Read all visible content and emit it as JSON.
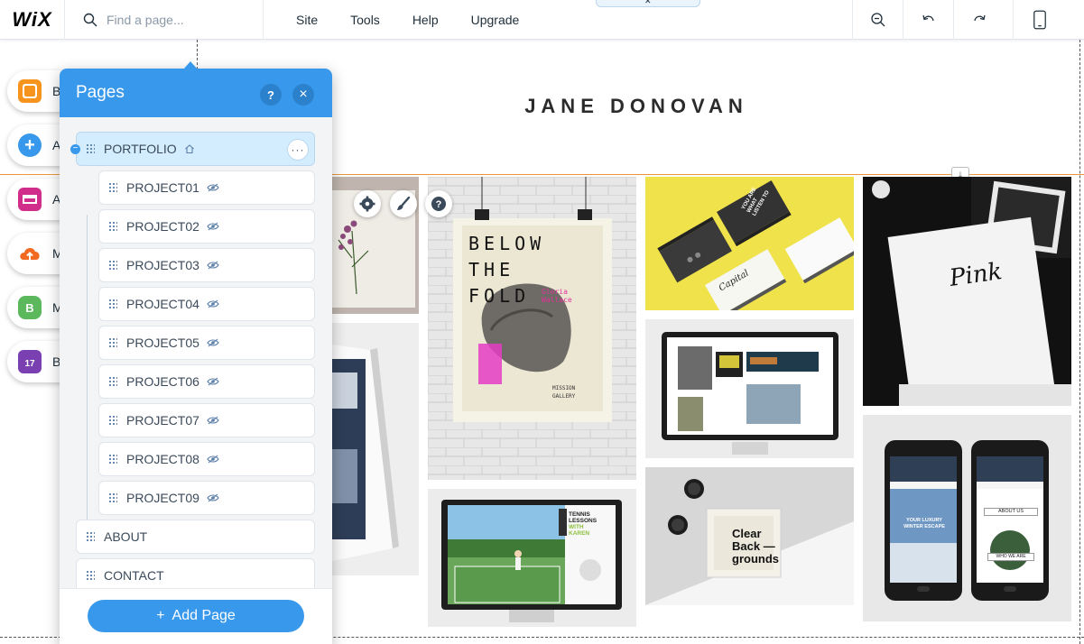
{
  "topbar": {
    "logo": "WiX",
    "search_placeholder": "Find a page...",
    "menu": [
      "Site",
      "Tools",
      "Help",
      "Upgrade"
    ],
    "icons": [
      "zoom-out-icon",
      "undo-icon",
      "redo-icon",
      "mobile-view-icon"
    ]
  },
  "site": {
    "title": "JANE DONOVAN"
  },
  "left_panel": {
    "items": [
      {
        "letter": "B",
        "icon": "background-icon",
        "color": "#f7941d"
      },
      {
        "letter": "A",
        "icon": "add-icon",
        "color": "#3899ec"
      },
      {
        "letter": "A",
        "icon": "app-market-icon",
        "color": "#d12d8b"
      },
      {
        "letter": "M",
        "icon": "media-upload-icon",
        "color": "#f26a21"
      },
      {
        "letter": "M",
        "icon": "blog-icon",
        "color": "#5cb85c"
      },
      {
        "letter": "B",
        "icon": "bookings-calendar-icon",
        "color": "#7a3fb0"
      }
    ],
    "calendar_day": "17",
    "blog_badge": "B"
  },
  "pages_panel": {
    "title": "Pages",
    "help": "?",
    "close": "×",
    "pages": [
      {
        "label": "PORTFOLIO",
        "home": true,
        "selected": true,
        "hidden": false,
        "child": false
      },
      {
        "label": "PROJECT01",
        "home": false,
        "selected": false,
        "hidden": true,
        "child": true
      },
      {
        "label": "PROJECT02",
        "home": false,
        "selected": false,
        "hidden": true,
        "child": true
      },
      {
        "label": "PROJECT03",
        "home": false,
        "selected": false,
        "hidden": true,
        "child": true
      },
      {
        "label": "PROJECT04",
        "home": false,
        "selected": false,
        "hidden": true,
        "child": true
      },
      {
        "label": "PROJECT05",
        "home": false,
        "selected": false,
        "hidden": true,
        "child": true
      },
      {
        "label": "PROJECT06",
        "home": false,
        "selected": false,
        "hidden": true,
        "child": true
      },
      {
        "label": "PROJECT07",
        "home": false,
        "selected": false,
        "hidden": true,
        "child": true
      },
      {
        "label": "PROJECT08",
        "home": false,
        "selected": false,
        "hidden": true,
        "child": true
      },
      {
        "label": "PROJECT09",
        "home": false,
        "selected": false,
        "hidden": true,
        "child": true
      },
      {
        "label": "ABOUT",
        "home": false,
        "selected": false,
        "hidden": false,
        "child": false
      },
      {
        "label": "CONTACT",
        "home": false,
        "selected": false,
        "hidden": false,
        "child": false
      }
    ],
    "more": "···",
    "collapse": "−",
    "add_page_plus": "+",
    "add_page": "Add Page"
  },
  "gallery": {
    "poster": {
      "line1": "BELOW",
      "line2": "THE",
      "line3": "FOLD",
      "author": "Gloria Wallace",
      "gallery1": "MISSION",
      "gallery2": "GALLERY"
    },
    "cards": {
      "c1": "YOU ARE WHAT LISTEN TO",
      "c2": "Capital"
    },
    "pink": "Pink",
    "tennis": {
      "l1": "TENNIS",
      "l2": "LESSONS",
      "l3": "WITH",
      "l4": "KAREN"
    },
    "cd": {
      "l1": "Clear",
      "l2": "Back —",
      "l3": "grounds"
    },
    "phone1": {
      "l1": "YOUR LUXURY",
      "l2": "WINTER ESCAPE"
    },
    "phone2": {
      "l1": "ABOUT US",
      "l2": "WHO WE ARE"
    }
  },
  "colors": {
    "accent": "#3899ec",
    "selected_row": "#d3edff",
    "section_line": "#e8983a"
  }
}
